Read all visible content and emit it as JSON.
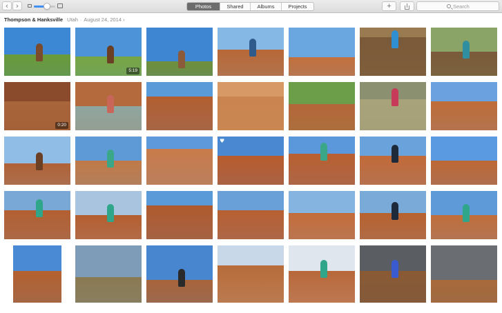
{
  "toolbar": {
    "back_glyph": "‹",
    "forward_glyph": "›",
    "zoom_level": 0.6,
    "tabs": [
      {
        "label": "Photos",
        "active": true
      },
      {
        "label": "Shared",
        "active": false
      },
      {
        "label": "Albums",
        "active": false
      },
      {
        "label": "Projects",
        "active": false
      }
    ],
    "add_glyph": "+",
    "search_placeholder": "Search"
  },
  "moment": {
    "title": "Thompson & Hanksville",
    "location": "Utah",
    "separator": "·",
    "date": "August 24, 2014",
    "chevron": "›"
  },
  "colors": {
    "accent": "#3d8ef5",
    "sky_blue": "#4a8fd6",
    "red_rock": "#b5602f",
    "sandstone": "#d0895a",
    "grass": "#6a9a3a",
    "storm_gray": "#5a5e63"
  },
  "photos": [
    {
      "row": 0,
      "col": 0,
      "sky": "#3c88d4",
      "ground": "#6a9a3a",
      "horizon": 0.55,
      "figure": "#7a4b2c"
    },
    {
      "row": 0,
      "col": 1,
      "sky": "#4c93d8",
      "ground": "#78a544",
      "horizon": 0.6,
      "figure": "#6b3f24",
      "video_duration": "5:19"
    },
    {
      "row": 0,
      "col": 2,
      "sky": "#3e86d2",
      "ground": "#6f8f3a",
      "horizon": 0.7,
      "figure": "#8a5a3a"
    },
    {
      "row": 0,
      "col": 3,
      "sky": "#86b8e6",
      "ground": "#b86836",
      "horizon": 0.45,
      "figure": "#2e5b8c"
    },
    {
      "row": 0,
      "col": 4,
      "sky": "#6aa6e0",
      "ground": "#c2703c",
      "horizon": 0.62
    },
    {
      "row": 0,
      "col": 5,
      "sky": "#9a7a50",
      "ground": "#7a5a38",
      "horizon": 0.2,
      "figure": "#2f8fd0"
    },
    {
      "row": 0,
      "col": 6,
      "sky": "#8aa468",
      "ground": "#7a5a3a",
      "horizon": 0.5,
      "figure": "#2f8fa0"
    },
    {
      "row": 1,
      "col": 0,
      "sky": "#8a4a2c",
      "ground": "#a8643a",
      "horizon": 0.4,
      "video_duration": "0:20"
    },
    {
      "row": 1,
      "col": 1,
      "sky": "#b56a3e",
      "ground": "#8fa6a0",
      "horizon": 0.5,
      "figure": "#c8665a"
    },
    {
      "row": 1,
      "col": 2,
      "sky": "#5a9ad8",
      "ground": "#b35e30",
      "horizon": 0.3
    },
    {
      "row": 1,
      "col": 3,
      "sky": "#d79a66",
      "ground": "#c9844f",
      "horizon": 0.3
    },
    {
      "row": 1,
      "col": 4,
      "sky": "#6c9e4a",
      "ground": "#b5673a",
      "horizon": 0.45
    },
    {
      "row": 1,
      "col": 5,
      "sky": "#8a9070",
      "ground": "#a9a37a",
      "horizon": 0.35,
      "figure": "#c73a5a"
    },
    {
      "row": 1,
      "col": 6,
      "sky": "#6aa1de",
      "ground": "#bf6c38",
      "horizon": 0.4
    },
    {
      "row": 2,
      "col": 0,
      "sky": "#8fbde6",
      "ground": "#b06236",
      "horizon": 0.55,
      "figure": "#6b3f24"
    },
    {
      "row": 2,
      "col": 1,
      "sky": "#5d9ad6",
      "ground": "#c07a48",
      "horizon": 0.5,
      "figure": "#3aa888"
    },
    {
      "row": 2,
      "col": 2,
      "sky": "#5e9adb",
      "ground": "#c97b4a",
      "horizon": 0.25
    },
    {
      "row": 2,
      "col": 3,
      "sky": "#4a88d2",
      "ground": "#b85c2e",
      "horizon": 0.4,
      "heart": true
    },
    {
      "row": 2,
      "col": 4,
      "sky": "#5a98db",
      "ground": "#b95f30",
      "horizon": 0.35,
      "figure": "#3aa888"
    },
    {
      "row": 2,
      "col": 5,
      "sky": "#6aa2dc",
      "ground": "#c26a38",
      "horizon": 0.4,
      "figure": "#1e2a3a"
    },
    {
      "row": 2,
      "col": 6,
      "sky": "#5a9ae0",
      "ground": "#bd6836",
      "horizon": 0.5
    },
    {
      "row": 3,
      "col": 0,
      "sky": "#7aa8d6",
      "ground": "#b35f30",
      "horizon": 0.4,
      "figure": "#2fa58a"
    },
    {
      "row": 3,
      "col": 1,
      "sky": "#a8c4de",
      "ground": "#b45e30",
      "horizon": 0.5,
      "figure": "#2fa58a"
    },
    {
      "row": 3,
      "col": 2,
      "sky": "#5a9ad8",
      "ground": "#b05a2e",
      "horizon": 0.3
    },
    {
      "row": 3,
      "col": 3,
      "sky": "#6aa0d8",
      "ground": "#b85f31",
      "horizon": 0.4
    },
    {
      "row": 3,
      "col": 4,
      "sky": "#86b4e0",
      "ground": "#c36c3a",
      "horizon": 0.45
    },
    {
      "row": 3,
      "col": 5,
      "sky": "#7aaad8",
      "ground": "#b8622f",
      "horizon": 0.45,
      "figure": "#1e2a3a"
    },
    {
      "row": 3,
      "col": 6,
      "sky": "#5e9ad8",
      "ground": "#c06e3c",
      "horizon": 0.5,
      "figure": "#2fa58a"
    },
    {
      "row": 4,
      "col": 0,
      "sky": "#4a8ad4",
      "ground": "#b3612f",
      "horizon": 0.45,
      "portrait": true
    },
    {
      "row": 4,
      "col": 1,
      "sky": "#7e9cb8",
      "ground": "#8a7a52",
      "horizon": 0.55
    },
    {
      "row": 4,
      "col": 2,
      "sky": "#4886d0",
      "ground": "#a8643a",
      "horizon": 0.6,
      "figure": "#2a2a2a"
    },
    {
      "row": 4,
      "col": 3,
      "sky": "#c8d8e8",
      "ground": "#b86c3a",
      "horizon": 0.35
    },
    {
      "row": 4,
      "col": 4,
      "sky": "#dfe6ee",
      "ground": "#b8683a",
      "horizon": 0.45,
      "figure": "#2fa58a"
    },
    {
      "row": 4,
      "col": 5,
      "sky": "#5a5e63",
      "ground": "#8a5a34",
      "horizon": 0.45,
      "figure": "#3a5ad0"
    },
    {
      "row": 4,
      "col": 6,
      "sky": "#6a6e73",
      "ground": "#a86a3a",
      "horizon": 0.6
    }
  ]
}
